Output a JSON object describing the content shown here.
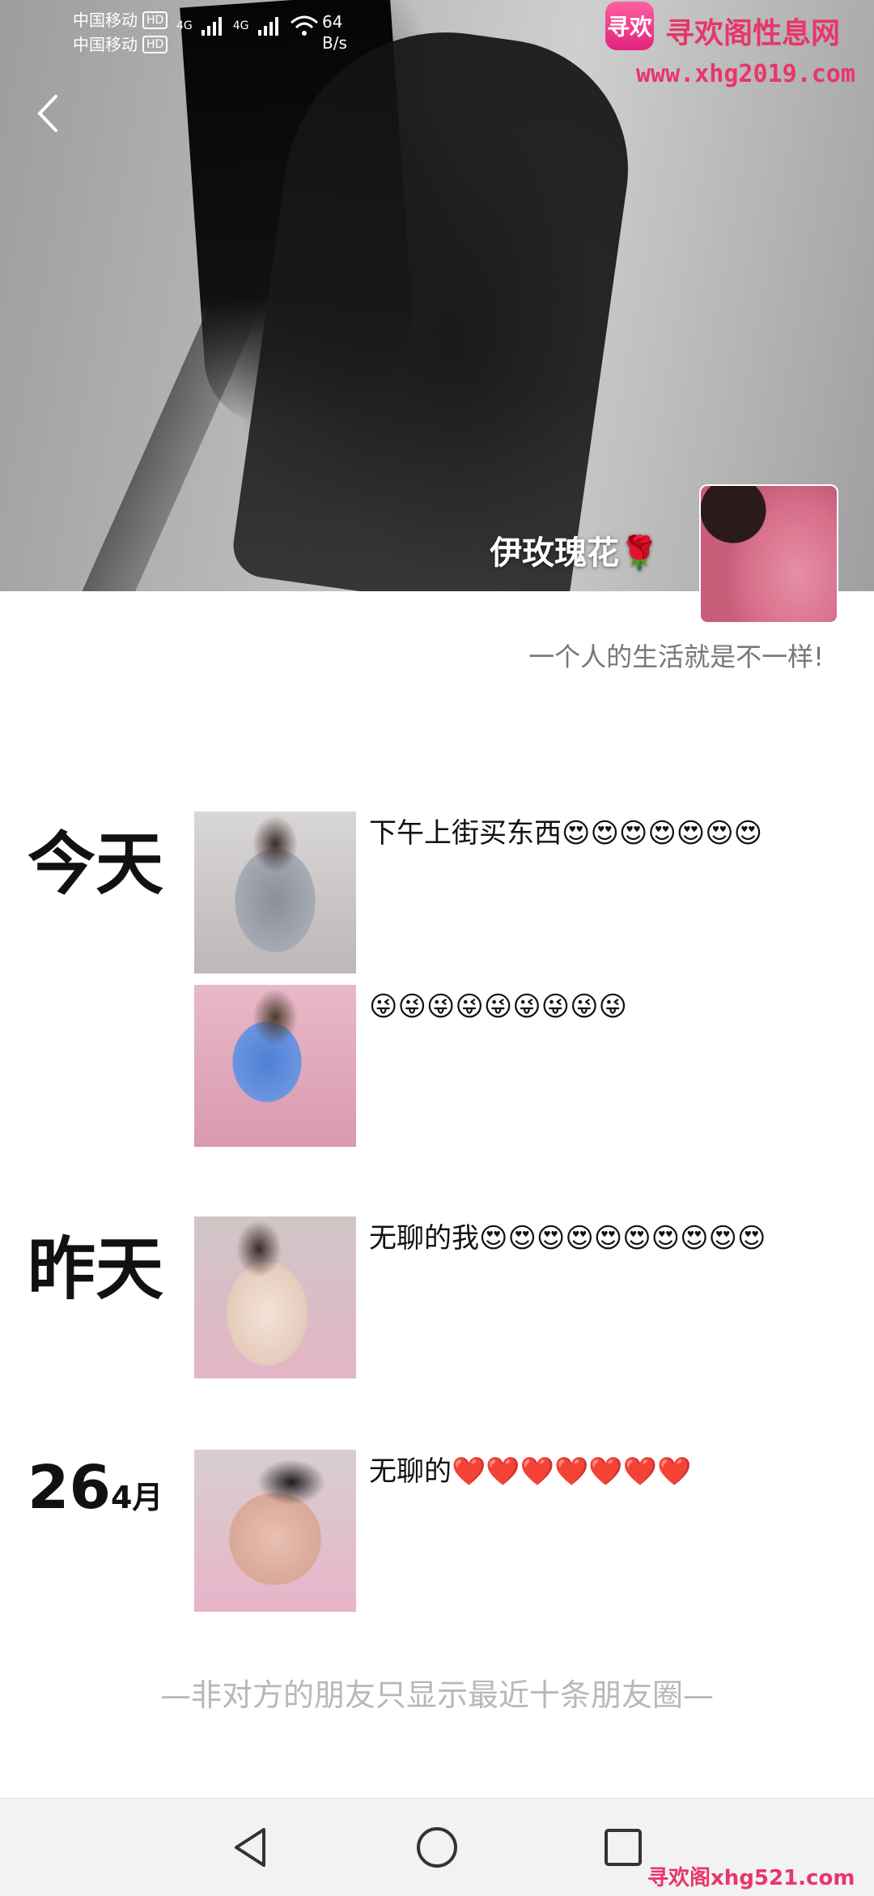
{
  "status_bar": {
    "carrier1": "中国移动",
    "carrier2": "中国移动",
    "hd": "HD",
    "signal_label": "4G",
    "net_speed_value": "64",
    "net_speed_unit": "B/s"
  },
  "watermark": {
    "logo_text": "寻欢",
    "site_name": "寻欢阁性息网",
    "site_url": "www.xhg2019.com",
    "bottom_text": "寻欢阁xhg521.com"
  },
  "profile": {
    "name": "伊玫瑰花🌹",
    "signature": "一个人的生活就是不一样!"
  },
  "timeline": {
    "today_label": "今天",
    "yesterday_label": "昨天",
    "date_day": "26",
    "date_month": "4月",
    "posts": [
      {
        "text": "下午上街买东西😍😍😍😍😍😍😍"
      },
      {
        "text": "😜😜😜😜😜😜😜😜😜"
      },
      {
        "text": "无聊的我😍😍😍😍😍😍😍😍😍😍"
      },
      {
        "text": "无聊的❤️❤️❤️❤️❤️❤️❤️"
      }
    ]
  },
  "footer_note": "—非对方的朋友只显示最近十条朋友圈—",
  "navigation": {
    "back": "back-icon",
    "home": "home-icon",
    "recents": "recents-icon"
  },
  "colors": {
    "watermark": "#e8356b",
    "footer_text": "#b8b8b8",
    "signature_text": "#777777"
  }
}
